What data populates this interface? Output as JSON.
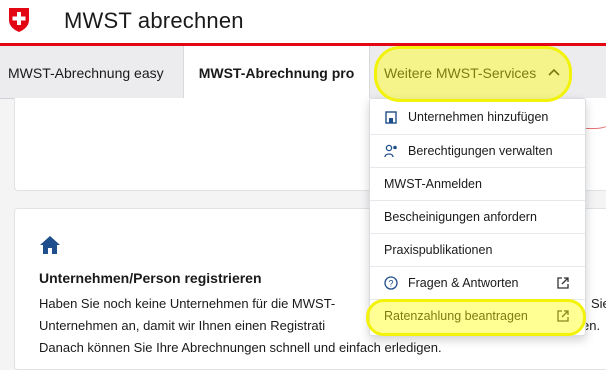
{
  "app": {
    "title": "MWST abrechnen"
  },
  "colors": {
    "brand_red": "#e30613",
    "highlight": "#f2f20a",
    "link_blue": "#1a5fb4"
  },
  "tabs": [
    {
      "label": "MWST-Abrechnung easy"
    },
    {
      "label": "MWST-Abrechnung pro"
    },
    {
      "label": "Weitere MWST-Services"
    }
  ],
  "menu": {
    "items": [
      {
        "label": "Unternehmen hinzufügen",
        "icon": "building-icon"
      },
      {
        "label": "Berechtigungen verwalten",
        "icon": "user-permissions-icon"
      },
      {
        "label": "MWST-Anmelden"
      },
      {
        "label": "Bescheinigungen anfordern"
      },
      {
        "label": "Praxispublikationen"
      },
      {
        "label": "Fragen & Antworten",
        "icon": "help-icon",
        "external": true
      },
      {
        "label": "Ratenzahlung beantragen",
        "external": true
      }
    ]
  },
  "card": {
    "title": "Unternehmen/Person registrieren",
    "line1_start": "Haben Sie noch keine Unternehmen für die MWST-",
    "line1_end": "Sie",
    "line2_start": "Unternehmen an, damit wir Ihnen einen Registrati",
    "line2_end": "en.",
    "line3": "Danach können Sie Ihre Abrechnungen schnell und einfach erledigen."
  }
}
